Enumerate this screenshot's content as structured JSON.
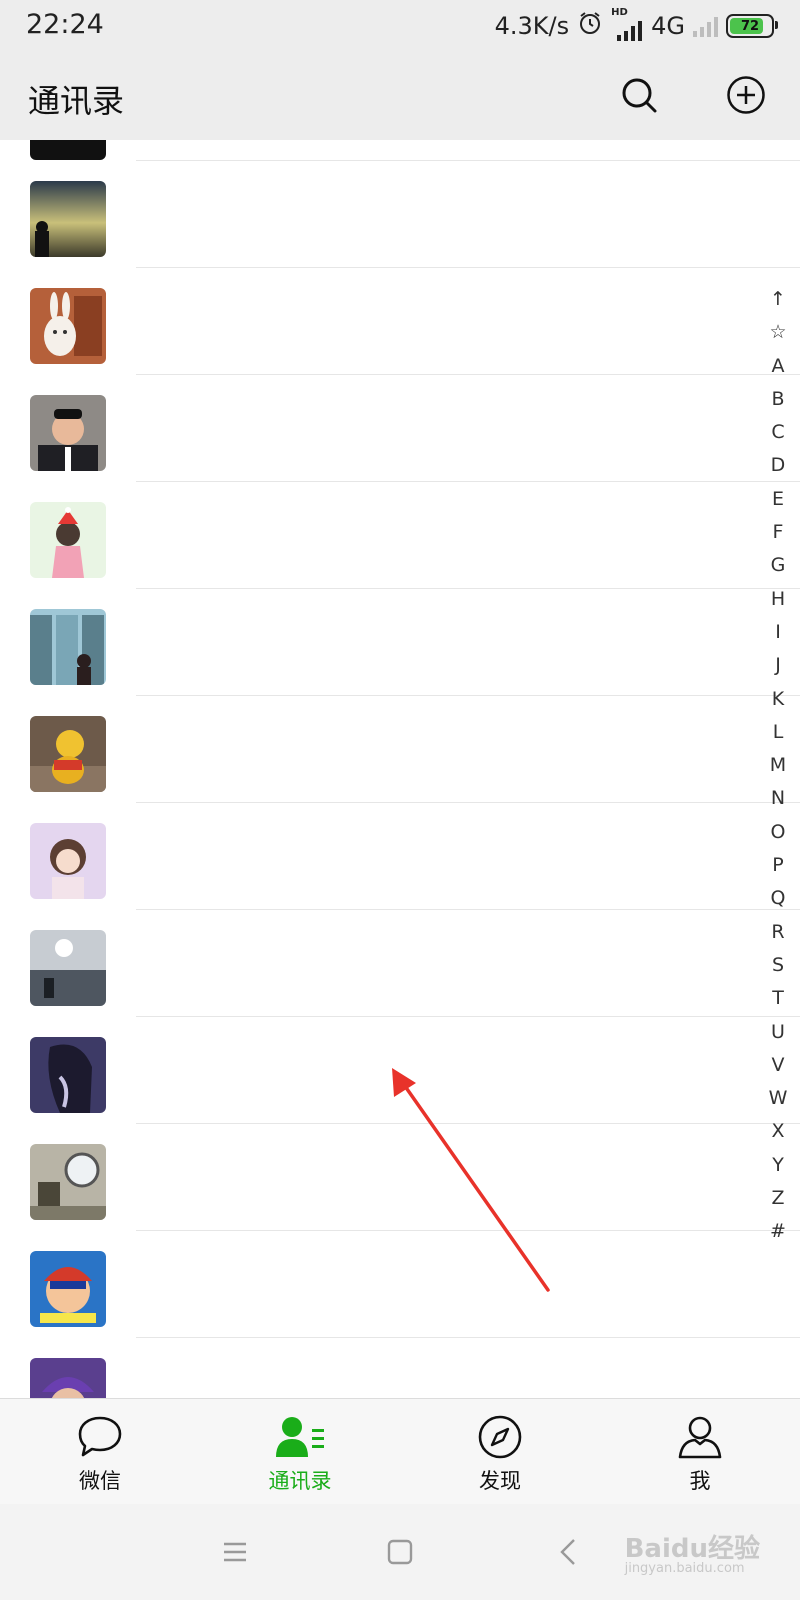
{
  "status_bar": {
    "time": "22:24",
    "net_speed": "4.3K/s",
    "network": "4G",
    "hd_label": "HD",
    "battery_level": "72",
    "battery_color": "#4cc34c"
  },
  "header": {
    "title": "通讯录",
    "search_icon": "search-icon",
    "add_icon": "plus-circle-icon"
  },
  "alphabet_index": [
    "↑",
    "☆",
    "A",
    "B",
    "C",
    "D",
    "E",
    "F",
    "G",
    "H",
    "I",
    "J",
    "K",
    "L",
    "M",
    "N",
    "O",
    "P",
    "Q",
    "R",
    "S",
    "T",
    "U",
    "V",
    "W",
    "X",
    "Y",
    "Z",
    "#"
  ],
  "contacts": [
    {
      "name": ""
    },
    {
      "name": ""
    },
    {
      "name": ""
    },
    {
      "name": ""
    },
    {
      "name": ""
    },
    {
      "name": ""
    },
    {
      "name": ""
    },
    {
      "name": ""
    },
    {
      "name": ""
    },
    {
      "name": ""
    },
    {
      "name": ""
    },
    {
      "name": ""
    },
    {
      "name": ""
    }
  ],
  "tabs": [
    {
      "label": "微信",
      "icon": "chat-bubble-icon"
    },
    {
      "label": "通讯录",
      "icon": "contacts-icon",
      "active": true
    },
    {
      "label": "发现",
      "icon": "compass-icon"
    },
    {
      "label": "我",
      "icon": "person-icon"
    }
  ],
  "accent_color": "#1aad19",
  "nav_bar": {
    "menu_icon": "menu-icon",
    "home_icon": "home-square-icon",
    "back_icon": "back-chevron-icon"
  },
  "watermark": {
    "main": "Baidu经验",
    "sub": "jingyan.baidu.com"
  }
}
